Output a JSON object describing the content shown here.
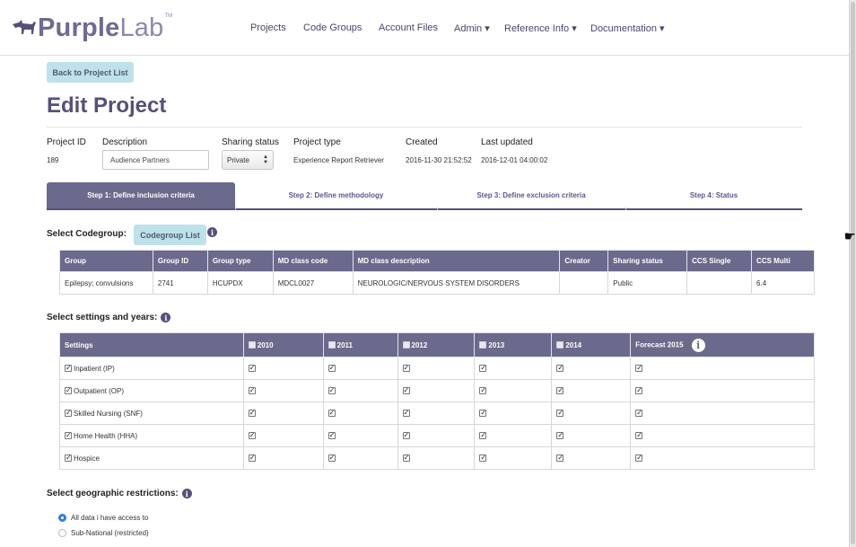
{
  "logo": {
    "part1": "Purple",
    "part2": "Lab",
    "tm": "TM"
  },
  "nav": {
    "items": [
      {
        "label": "Projects"
      },
      {
        "label": "Code Groups"
      },
      {
        "label": "Account Files"
      },
      {
        "label": "Admin ▾"
      },
      {
        "label": "Reference Info ▾"
      },
      {
        "label": "Documentation ▾"
      }
    ]
  },
  "back_button": "Back to Project List",
  "page_title": "Edit Project",
  "project": {
    "id_label": "Project ID",
    "id_value": "189",
    "description_label": "Description",
    "description_value": "Audience Partners",
    "sharing_label": "Sharing status",
    "sharing_value": "Private",
    "type_label": "Project type",
    "type_value": "Experience Report Retriever",
    "created_label": "Created",
    "created_value": "2016-11-30 21:52:52",
    "updated_label": "Last updated",
    "updated_value": "2016-12-01 04:00:02"
  },
  "steps": [
    {
      "label": "Step 1: Define inclusion criteria",
      "active": true
    },
    {
      "label": "Step 2: Define methodology",
      "active": false
    },
    {
      "label": "Step 3: Define exclusion criteria",
      "active": false
    },
    {
      "label": "Step 4: Status",
      "active": false
    }
  ],
  "codegroup": {
    "heading": "Select Codegroup:",
    "button": "Codegroup List",
    "columns": [
      "Group",
      "Group ID",
      "Group type",
      "MD class code",
      "MD class description",
      "Creator",
      "Sharing status",
      "CCS Single",
      "CCS Multi"
    ],
    "rows": [
      [
        "Epilepsy; convulsions",
        "2741",
        "HCUPDX",
        "MDCL0027",
        "NEUROLOGIC/NERVOUS SYSTEM DISORDERS",
        "",
        "Public",
        "",
        "6.4"
      ]
    ]
  },
  "settings": {
    "heading": "Select settings and years:",
    "settings_col": "Settings",
    "years": [
      "2010",
      "2011",
      "2012",
      "2013",
      "2014"
    ],
    "forecast_label": "Forecast 2015",
    "rows": [
      {
        "label": "Inpatient (IP)"
      },
      {
        "label": "Outpatient (OP)"
      },
      {
        "label": "Skilled Nursing (SNF)"
      },
      {
        "label": "Home Health (HHA)"
      },
      {
        "label": "Hospice"
      }
    ]
  },
  "geo": {
    "heading": "Select geographic restrictions:",
    "options": [
      {
        "label": "All data i have access to",
        "selected": true
      },
      {
        "label": "Sub-National (restricted)",
        "selected": false
      }
    ]
  },
  "colors": {
    "brand": "#55507a",
    "header_bg": "#6b6a8c",
    "button_light": "#bfe1ea",
    "radio_selected": "#2f7ee0"
  }
}
